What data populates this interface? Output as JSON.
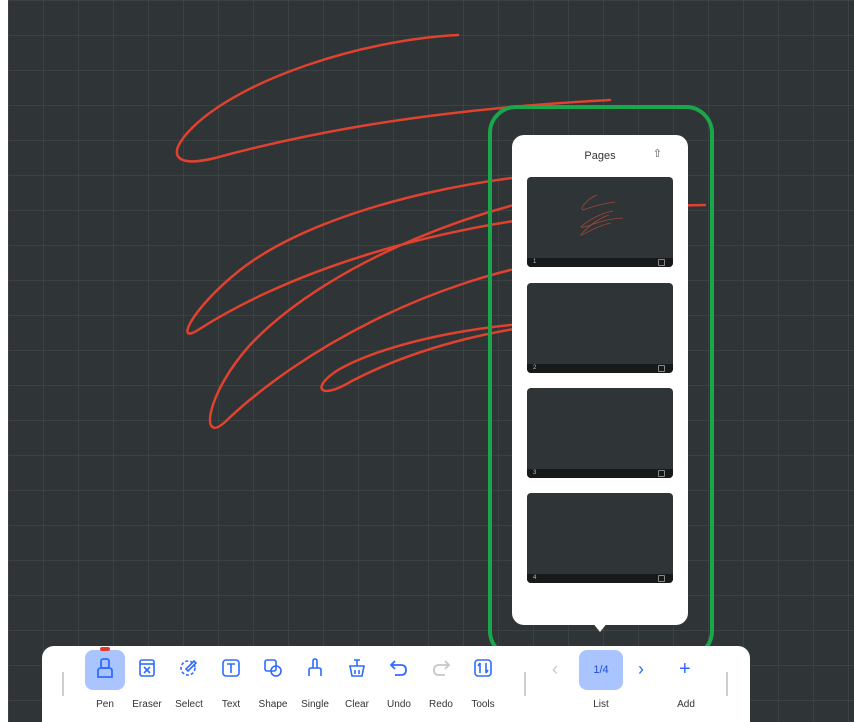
{
  "colors": {
    "board": "#2f3436",
    "stroke": "#e0422f",
    "accent": "#2f6bff",
    "highlight": "#1aa64a"
  },
  "pages_panel": {
    "title": "Pages",
    "pin_icon": "pin-icon",
    "current_page": 1,
    "pages": [
      {
        "number": "1",
        "has_content": true
      },
      {
        "number": "2",
        "has_content": false
      },
      {
        "number": "3",
        "has_content": false
      },
      {
        "number": "4",
        "has_content": false
      }
    ]
  },
  "toolbar": {
    "tools": [
      {
        "id": "pen",
        "label": "Pen",
        "icon": "pen-icon",
        "active": true
      },
      {
        "id": "eraser",
        "label": "Eraser",
        "icon": "eraser-icon"
      },
      {
        "id": "select",
        "label": "Select",
        "icon": "select-icon"
      },
      {
        "id": "text",
        "label": "Text",
        "icon": "text-icon"
      },
      {
        "id": "shape",
        "label": "Shape",
        "icon": "shape-icon"
      },
      {
        "id": "single",
        "label": "Single",
        "icon": "single-icon"
      },
      {
        "id": "clear",
        "label": "Clear",
        "icon": "clear-icon"
      },
      {
        "id": "undo",
        "label": "Undo",
        "icon": "undo-icon"
      },
      {
        "id": "redo",
        "label": "Redo",
        "icon": "redo-icon",
        "disabled": true
      },
      {
        "id": "tools",
        "label": "Tools",
        "icon": "tools-icon"
      }
    ],
    "page_indicator": "1/4",
    "list_label": "List",
    "add_label": "Add",
    "prev_icon": "chevron-left-icon",
    "next_icon": "chevron-right-icon",
    "add_icon": "plus-icon"
  }
}
